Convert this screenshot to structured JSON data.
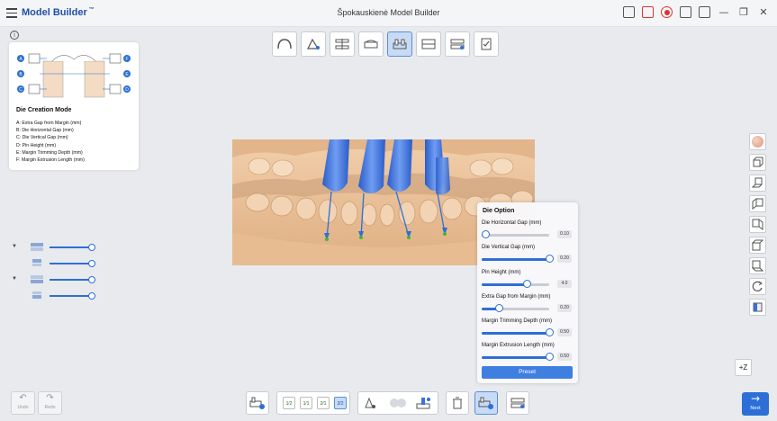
{
  "titlebar": {
    "app_name": "Model Builder",
    "app_badge": "™",
    "window_title": "Špokauskienė Model Builder",
    "icons": [
      "screenshot-icon",
      "document-icon",
      "record-icon",
      "camera-icon",
      "window-icon"
    ],
    "minimize": "—",
    "maximize": "❐",
    "close": "✕"
  },
  "info_panel": {
    "info_glyph": "i",
    "diagram_markers": [
      "A",
      "B",
      "C",
      "D",
      "E",
      "F"
    ],
    "title": "Die Creation Mode",
    "lines": [
      "A: Extra Gap from Margin (mm)",
      "B: Die Horizontal Gap (mm)",
      "C: Die Vertical Gap (mm)",
      "D: Pin Height (mm)",
      "E: Margin Trimming Depth (mm)",
      "F: Margin Extrusion Length (mm)"
    ]
  },
  "top_toolbar": {
    "buttons": [
      "arch-icon",
      "trim-icon",
      "align-icon",
      "base-icon",
      "die-icon",
      "model-icon",
      "articulator-icon",
      "check-icon"
    ],
    "active_index": 4
  },
  "die_option": {
    "title": "Die Option",
    "options": [
      {
        "label": "Die Horizontal Gap (mm)",
        "value": "0.10",
        "fraction": 0.05
      },
      {
        "label": "Die Vertical Gap (mm)",
        "value": "0.20",
        "fraction": 1.0
      },
      {
        "label": "Pin Height (mm)",
        "value": "4.0",
        "fraction": 0.67
      },
      {
        "label": "Extra Gap from Margin (mm)",
        "value": "0.20",
        "fraction": 0.25
      },
      {
        "label": "Margin Trimming Depth (mm)",
        "value": "0.50",
        "fraction": 1.0
      },
      {
        "label": "Margin Extrusion Length (mm)",
        "value": "0.50",
        "fraction": 1.0
      }
    ],
    "preset_label": "Preset"
  },
  "layers": [
    {
      "name": "upper-jaw",
      "expandable": true,
      "opacity": 1.0
    },
    {
      "name": "upper-base",
      "expandable": false,
      "opacity": 1.0
    },
    {
      "name": "lower-jaw",
      "expandable": true,
      "opacity": 1.0
    },
    {
      "name": "lower-base",
      "expandable": false,
      "opacity": 1.0
    }
  ],
  "view_tools": [
    "material-icon",
    "front-view-icon",
    "back-view-icon",
    "left-view-icon",
    "right-view-icon",
    "top-view-icon",
    "bottom-view-icon",
    "reset-view-icon",
    "texture-icon"
  ],
  "z_button": "+Z",
  "undo": {
    "glyph": "↶",
    "label": "Undo"
  },
  "redo": {
    "glyph": "↷",
    "label": "Redo"
  },
  "bottom_toolbar": {
    "numbers": [
      "1⁄2",
      "1⁄1",
      "2⁄1",
      "2⁄2"
    ],
    "active_number_index": 3
  },
  "next": {
    "glyph": "→",
    "label": "Next"
  },
  "colors": {
    "accent": "#2d6fd6",
    "model": "#e9c39b",
    "pin": "#3d6fe0",
    "active_bg": "#c7dbf6"
  }
}
